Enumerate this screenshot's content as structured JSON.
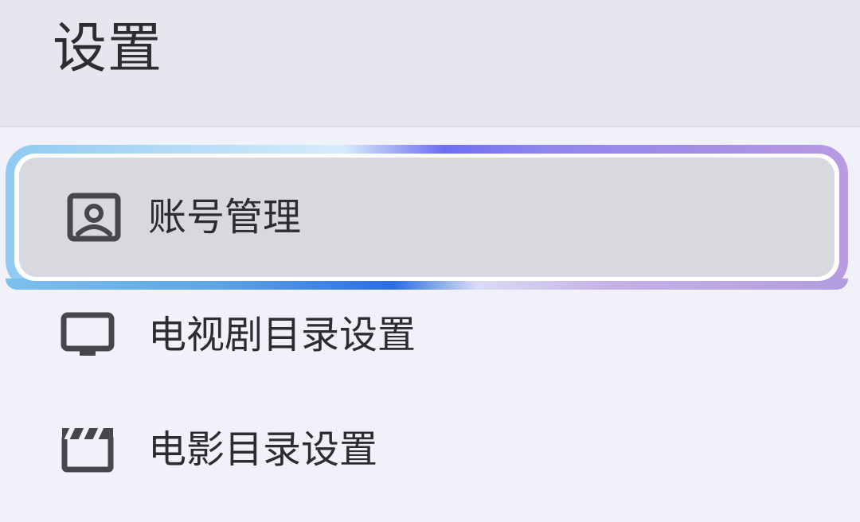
{
  "header": {
    "title": "设置"
  },
  "menu": {
    "items": [
      {
        "label": "账号管理",
        "icon": "account-portrait-icon",
        "selected": true
      },
      {
        "label": "电视剧目录设置",
        "icon": "tv-icon",
        "selected": false
      },
      {
        "label": "电影目录设置",
        "icon": "clapperboard-icon",
        "selected": false
      }
    ]
  },
  "colors": {
    "header_bg": "#e6e7ee",
    "page_bg": "#f1f1fa",
    "selected_bg": "#d8d9df",
    "focus_gradient_start": "#8fcaf2",
    "focus_gradient_mid": "#6f6ef2",
    "focus_gradient_end": "#b99be2",
    "icon_color": "#46474d",
    "text_color": "#2c2d31"
  }
}
